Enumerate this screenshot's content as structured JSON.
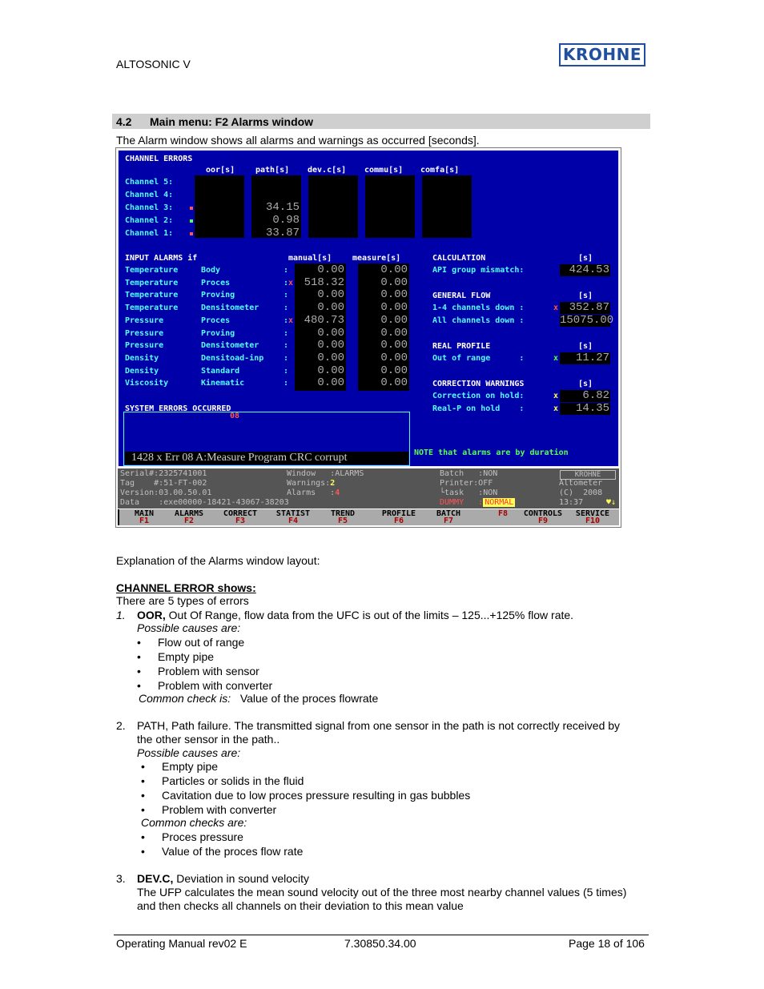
{
  "header": {
    "title": "ALTOSONIC V",
    "logo": "KROHNE"
  },
  "section": {
    "number": "4.2",
    "title": "Main menu: F2 Alarms window"
  },
  "intro": "The Alarm window shows all alarms and warnings as occurred [seconds].",
  "screen": {
    "channel_errors": {
      "title": "CHANNEL ERRORS",
      "columns": [
        "oor[s]",
        "path[s]",
        "dev.c[s]",
        "commu[s]",
        "comfa[s]"
      ],
      "rows": [
        {
          "label": "Channel 5:",
          "marker": "",
          "values": [
            "",
            "",
            "",
            "",
            ""
          ]
        },
        {
          "label": "Channel 4:",
          "marker": "",
          "values": [
            "",
            "",
            "",
            "",
            ""
          ]
        },
        {
          "label": "Channel 3:",
          "marker": "red",
          "values": [
            "",
            "34.15",
            "",
            "",
            ""
          ]
        },
        {
          "label": "Channel 2:",
          "marker": "green",
          "values": [
            "",
            "0.98",
            "",
            "",
            ""
          ]
        },
        {
          "label": "Channel 1:",
          "marker": "red",
          "values": [
            "",
            "33.87",
            "",
            "",
            ""
          ]
        }
      ]
    },
    "input_alarms": {
      "title": "INPUT ALARMS if",
      "col_manual": "manual[s]",
      "col_measure": "measure[s]",
      "rows": [
        {
          "type": "Temperature",
          "source": "Body",
          "sep": ":",
          "flag": "",
          "manual": "0.00",
          "measure": "0.00"
        },
        {
          "type": "Temperature",
          "source": "Proces",
          "sep": ":",
          "flag": "x",
          "manual": "518.32",
          "measure": "0.00"
        },
        {
          "type": "Temperature",
          "source": "Proving",
          "sep": ":",
          "flag": "",
          "manual": "0.00",
          "measure": "0.00"
        },
        {
          "type": "Temperature",
          "source": "Densitometer",
          "sep": ":",
          "flag": "",
          "manual": "0.00",
          "measure": "0.00"
        },
        {
          "type": "Pressure",
          "source": "Proces",
          "sep": ":",
          "flag": "x",
          "manual": "480.73",
          "measure": "0.00"
        },
        {
          "type": "Pressure",
          "source": "Proving",
          "sep": ":",
          "flag": "",
          "manual": "0.00",
          "measure": "0.00"
        },
        {
          "type": "Pressure",
          "source": "Densitometer",
          "sep": ":",
          "flag": "",
          "manual": "0.00",
          "measure": "0.00"
        },
        {
          "type": "Density",
          "source": "Densitoad-inp",
          "sep": ":",
          "flag": "",
          "manual": "0.00",
          "measure": "0.00"
        },
        {
          "type": "Density",
          "source": "Standard",
          "sep": ":",
          "flag": "",
          "manual": "0.00",
          "measure": "0.00"
        },
        {
          "type": "Viscosity",
          "source": "Kinematic",
          "sep": ":",
          "flag": "",
          "manual": "0.00",
          "measure": "0.00"
        }
      ]
    },
    "right_panels": [
      {
        "title": "CALCULATION",
        "unit": "[s]",
        "rows": [
          {
            "label": "API group mismatch:",
            "flag": "",
            "flag_color": "",
            "value": "424.53"
          }
        ]
      },
      {
        "title": "GENERAL FLOW",
        "unit": "[s]",
        "rows": [
          {
            "label": "1-4 channels down :",
            "flag": "x",
            "flag_color": "red",
            "value": "352.87"
          },
          {
            "label": "All channels down :",
            "flag": "",
            "flag_color": "",
            "value": "15075.00"
          }
        ]
      },
      {
        "title": "REAL PROFILE",
        "unit": "[s]",
        "rows": [
          {
            "label": "Out of range      :",
            "flag": "x",
            "flag_color": "green",
            "value": "11.27"
          }
        ]
      },
      {
        "title": "CORRECTION WARNINGS",
        "unit": "[s]",
        "rows": [
          {
            "label": "Correction on hold:",
            "flag": "x",
            "flag_color": "yellow",
            "value": "6.82"
          },
          {
            "label": "Real-P on hold    :",
            "flag": "x",
            "flag_color": "yellow",
            "value": "14.35"
          }
        ]
      }
    ],
    "system_errors": {
      "title": "SYSTEM ERRORS OCCURRED",
      "code": "08",
      "message": "1428 x Err 08 A:Measure Program CRC corrupt"
    },
    "note": "NOTE that alarms are by duration",
    "status": {
      "serial_label": "Serial#:",
      "serial": "2325741001",
      "tag_label": "Tag    #:",
      "tag": "51-FT-002",
      "version_label": "Version:",
      "version": "03.00.50.01",
      "data_label": "Data    :",
      "data": "exe00000-18421-43067-38203",
      "window_label": "Window   :",
      "window": "ALARMS",
      "warnings_label": "Warnings:",
      "warnings": "2",
      "alarms_label": "Alarms   :",
      "alarms": "4",
      "batch_label": "Batch   :",
      "batch": "NON",
      "printer_label": "Printer:",
      "printer": "OFF",
      "task_label": "└task   :",
      "task": "NON",
      "dummy_label": "DUMMY   :",
      "dummy": "NORMAL",
      "brand": "KROHNE",
      "product": "Altometer",
      "copyright": "(C)  2008",
      "time": "13:37",
      "indicator": "♥↓"
    },
    "fkeys": [
      {
        "label": "MAIN",
        "key": "F1"
      },
      {
        "label": "ALARMS",
        "key": "F2"
      },
      {
        "label": "CORRECT",
        "key": "F3"
      },
      {
        "label": "STATIST",
        "key": "F4"
      },
      {
        "label": "TREND",
        "key": "F5"
      },
      {
        "label": "PROFILE",
        "key": "F6"
      },
      {
        "label": "BATCH",
        "key": "F7"
      },
      {
        "label": "",
        "key": "F8"
      },
      {
        "label": "CONTROLS",
        "key": "F9"
      },
      {
        "label": "SERVICE",
        "key": "F10"
      }
    ]
  },
  "body": {
    "explanation": "Explanation of the Alarms window layout:",
    "channel_error_heading": "CHANNEL ERROR shows:",
    "types_intro": "There are 5 types of errors",
    "item1": {
      "num": "1.",
      "bold": "OOR,",
      "text": " Out Of Range, flow data from the UFC is out of the limits – 125...+125% flow rate.",
      "causes_label": "Possible causes are:",
      "causes": [
        "Flow out of range",
        "Empty pipe",
        "Problem with sensor",
        "Problem with converter"
      ],
      "check_label": "Common check is:",
      "check_text": "Value of the proces flowrate"
    },
    "item2": {
      "num": "2.",
      "line1": "PATH, Path failure. The transmitted signal from one sensor in the path is not correctly received by",
      "line2": "the other sensor in the path..",
      "causes_label": "Possible causes are:",
      "causes": [
        "Empty pipe",
        "Particles or solids in the fluid",
        "Cavitation due to low proces pressure resulting in gas bubbles",
        "Problem with converter"
      ],
      "checks_label": "Common checks are:",
      "checks": [
        "Proces pressure",
        "Value of the proces flow rate"
      ]
    },
    "item3": {
      "num": "3.",
      "bold": "DEV.C,",
      "text": " Deviation in sound velocity",
      "line2": "The UFP calculates the mean sound velocity out of the three most nearby channel values (5 times)",
      "line3": "and then checks all channels on their deviation to this mean value"
    }
  },
  "footer": {
    "left": "Operating Manual  rev02 E",
    "center": "7.30850.34.00",
    "right": "Page 18 of 106"
  }
}
